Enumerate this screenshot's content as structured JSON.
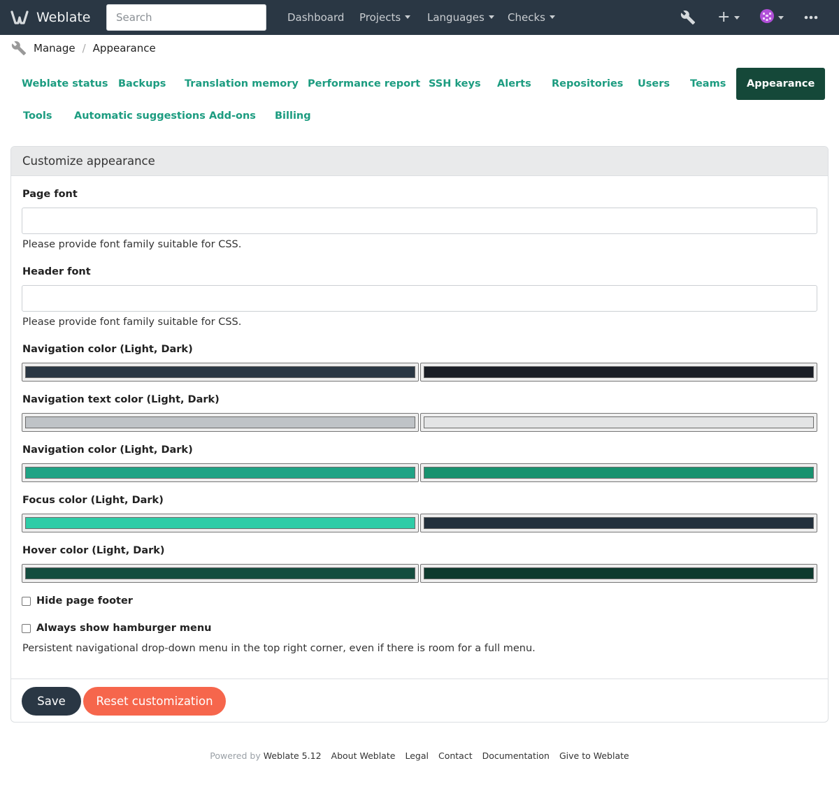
{
  "navbar": {
    "brand": "Weblate",
    "search_placeholder": "Search",
    "links": [
      "Dashboard",
      "Projects",
      "Languages",
      "Checks"
    ],
    "icons": [
      "wrench-icon",
      "plus-icon",
      "avatar",
      "more-icon"
    ]
  },
  "breadcrumb": {
    "manage": "Manage",
    "separator": "/",
    "current": "Appearance"
  },
  "tabs": {
    "row1": [
      "Weblate status",
      "Backups",
      "Translation memory",
      "Performance report",
      "SSH keys",
      "Alerts",
      "Repositories",
      "Users",
      "Teams",
      "Appearance"
    ],
    "row2": [
      "Tools",
      "Automatic suggestions",
      "Add-ons",
      "Billing"
    ],
    "active": "Appearance"
  },
  "panel": {
    "title": "Customize appearance",
    "page_font": {
      "label": "Page font",
      "value": "",
      "help": "Please provide font family suitable for CSS."
    },
    "header_font": {
      "label": "Header font",
      "value": "",
      "help": "Please provide font family suitable for CSS."
    },
    "colors": [
      {
        "label": "Navigation color (Light, Dark)",
        "light": "#2a3744",
        "dark": "#1a1e26"
      },
      {
        "label": "Navigation text color (Light, Dark)",
        "light": "#bfc3c7",
        "dark": "#e3e4e5"
      },
      {
        "label": "Navigation color (Light, Dark)",
        "light": "#1fa385",
        "dark": "#18926f"
      },
      {
        "label": "Focus color (Light, Dark)",
        "light": "#2ecca7",
        "dark": "#22303c"
      },
      {
        "label": "Hover color (Light, Dark)",
        "light": "#144d3f",
        "dark": "#0e3a2e"
      }
    ],
    "hide_footer": {
      "label": "Hide page footer",
      "checked": false
    },
    "hamburger": {
      "label": "Always show hamburger menu",
      "checked": false,
      "help": "Persistent navigational drop-down menu in the top right corner, even if there is room for a full menu."
    },
    "save_label": "Save",
    "reset_label": "Reset customization"
  },
  "footer": {
    "powered_by": "Powered by",
    "version": "Weblate 5.12",
    "links": [
      "About Weblate",
      "Legal",
      "Contact",
      "Documentation",
      "Give to Weblate"
    ]
  },
  "theme": {
    "accent": "#1c9c80",
    "active_tab": "#154839",
    "navbar": "#2a3744",
    "reset": "#f6664c"
  }
}
